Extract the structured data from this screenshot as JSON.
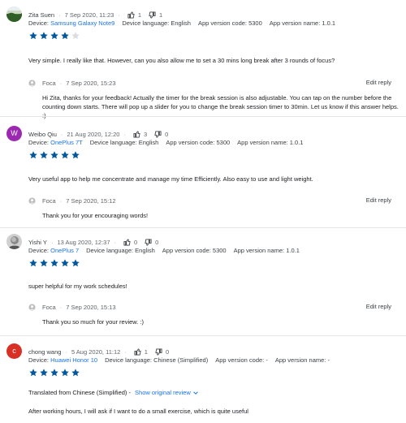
{
  "colors": {
    "link": "#1a73e8",
    "star": "#01579b",
    "sep": "#e4e4e4"
  },
  "reviews": [
    {
      "author": "Zita Suen",
      "date": "7 Sep 2020, 11:23",
      "thumbs_up": "1",
      "thumbs_down": "1",
      "device_label": "Device:",
      "device": "Samsung Galaxy Note9",
      "language": "Device language: English",
      "version_code": "App version code: 5300",
      "version_name": "App version name: 1.0.1",
      "rating": 4,
      "text": "Very simple. I really like that. However, can you also allow me to set a 30 mins long break after 3 rounds of focus?",
      "reply": {
        "author": "Foca",
        "date": "7 Sep 2020, 15:23",
        "edit": "Edit reply",
        "text": "Hi Zita, thanks for your feedback! Actually the timer for the break session is also adjustable. You can tap on the number before the counting down starts. There will pop up a slider for you to change the break session timer to 30min. Let us know if this answer helps. :)"
      }
    },
    {
      "author": "Weibo Qiu",
      "avatar_letter": "W",
      "avatar_color": "#9c27b0",
      "date": "21 Aug 2020, 12:20",
      "thumbs_up": "3",
      "thumbs_down": "0",
      "device_label": "Device:",
      "device": "OnePlus 7T",
      "language": "Device language: English",
      "version_code": "App version code: 5300",
      "version_name": "App version name: 1.0.1",
      "rating": 5,
      "text": "Very useful app to help me concentrate and manage my time Efficiently. Also easy to use and light weight.",
      "reply": {
        "author": "Foca",
        "date": "7 Sep 2020, 15:12",
        "edit": "Edit reply",
        "text": "Thank you for your encouraging words!"
      }
    },
    {
      "author": "Yishi Y",
      "date": "13 Aug 2020, 12:37",
      "thumbs_up": "0",
      "thumbs_down": "0",
      "device_label": "Device:",
      "device": "OnePlus 7",
      "language": "Device language: English",
      "version_code": "App version code: 5300",
      "version_name": "App version name: 1.0.1",
      "rating": 5,
      "text": "super helpful for my work schedules!",
      "reply": {
        "author": "Foca",
        "date": "7 Sep 2020, 15:13",
        "edit": "Edit reply",
        "text": "Thank you so much for your review. :)"
      }
    },
    {
      "author": "chong wang",
      "avatar_letter": "c",
      "avatar_color": "#d93025",
      "date": "5 Aug 2020, 11:12",
      "thumbs_up": "1",
      "thumbs_down": "0",
      "device_label": "Device:",
      "device": "Huawei Honor 10",
      "language": "Device language: Chinese (Simplified)",
      "version_code": "App version code: -",
      "version_name": "App version name: -",
      "rating": 5,
      "translated_from": "Translated from Chinese (Simplified) -",
      "show_original": "Show original review",
      "text": "After working hours, I will ask if I want to do a small exercise, which is quite useful"
    }
  ]
}
